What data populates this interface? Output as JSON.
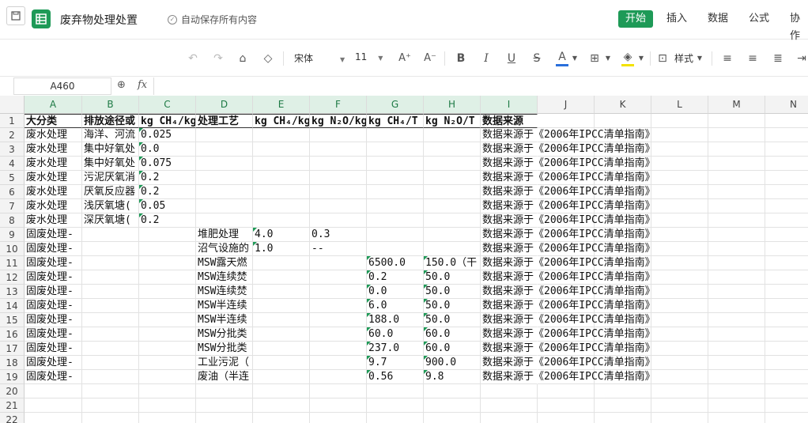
{
  "doc_title": "废弃物处理处置",
  "autosave_label": "自动保存所有内容",
  "menus": [
    "开始",
    "插入",
    "数据",
    "公式",
    "协作"
  ],
  "toolbar": {
    "font_name": "宋体",
    "font_size": "11",
    "style_label": "样式"
  },
  "name_box": "A460",
  "fx_label": "fx",
  "columns": [
    "A",
    "B",
    "C",
    "D",
    "E",
    "F",
    "G",
    "H",
    "I",
    "J",
    "K",
    "L",
    "M",
    "N"
  ],
  "rows": [
    [
      "大分类",
      "排放途径或",
      "kg CH₄/kg",
      "处理工艺",
      "kg CH₄/kg",
      "kg N₂O/kg",
      "kg CH₄/T",
      "kg N₂O/T",
      "数据来源"
    ],
    [
      "废水处理",
      "海洋、河流",
      "0.025",
      "",
      "",
      "",
      "",
      "",
      "数据来源于《2006年IPCC清单指南》"
    ],
    [
      "废水处理",
      "集中好氧处",
      "0.0",
      "",
      "",
      "",
      "",
      "",
      "数据来源于《2006年IPCC清单指南》"
    ],
    [
      "废水处理",
      "集中好氧处",
      "0.075",
      "",
      "",
      "",
      "",
      "",
      "数据来源于《2006年IPCC清单指南》"
    ],
    [
      "废水处理",
      "污泥厌氧消",
      "0.2",
      "",
      "",
      "",
      "",
      "",
      "数据来源于《2006年IPCC清单指南》"
    ],
    [
      "废水处理",
      "厌氧反应器",
      "0.2",
      "",
      "",
      "",
      "",
      "",
      "数据来源于《2006年IPCC清单指南》"
    ],
    [
      "废水处理",
      "浅厌氧塘(",
      "0.05",
      "",
      "",
      "",
      "",
      "",
      "数据来源于《2006年IPCC清单指南》"
    ],
    [
      "废水处理",
      "深厌氧塘(",
      "0.2",
      "",
      "",
      "",
      "",
      "",
      "数据来源于《2006年IPCC清单指南》"
    ],
    [
      "固废处理-",
      "",
      "",
      "堆肥处理",
      "4.0",
      "0.3",
      "",
      "",
      "数据来源于《2006年IPCC清单指南》"
    ],
    [
      "固废处理-",
      "",
      "",
      "沼气设施的",
      "1.0",
      "--",
      "",
      "",
      "数据来源于《2006年IPCC清单指南》"
    ],
    [
      "固废处理-",
      "",
      "",
      "MSW露天燃",
      "",
      "",
      "6500.0",
      "150.0（干",
      "数据来源于《2006年IPCC清单指南》"
    ],
    [
      "固废处理-",
      "",
      "",
      "MSW连续焚",
      "",
      "",
      "0.2",
      "50.0",
      "数据来源于《2006年IPCC清单指南》"
    ],
    [
      "固废处理-",
      "",
      "",
      "MSW连续焚",
      "",
      "",
      "0.0",
      "50.0",
      "数据来源于《2006年IPCC清单指南》"
    ],
    [
      "固废处理-",
      "",
      "",
      "MSW半连续",
      "",
      "",
      "6.0",
      "50.0",
      "数据来源于《2006年IPCC清单指南》"
    ],
    [
      "固废处理-",
      "",
      "",
      "MSW半连续",
      "",
      "",
      "188.0",
      "50.0",
      "数据来源于《2006年IPCC清单指南》"
    ],
    [
      "固废处理-",
      "",
      "",
      "MSW分批类",
      "",
      "",
      "60.0",
      "60.0",
      "数据来源于《2006年IPCC清单指南》"
    ],
    [
      "固废处理-",
      "",
      "",
      "MSW分批类",
      "",
      "",
      "237.0",
      "60.0",
      "数据来源于《2006年IPCC清单指南》"
    ],
    [
      "固废处理-",
      "",
      "",
      "工业污泥（",
      "",
      "",
      "9.7",
      "900.0",
      "数据来源于《2006年IPCC清单指南》"
    ],
    [
      "固废处理-",
      "",
      "",
      "废油（半连",
      "",
      "",
      "0.56",
      "9.8",
      "数据来源于《2006年IPCC清单指南》"
    ],
    [
      "",
      "",
      "",
      "",
      "",
      "",
      "",
      "",
      ""
    ],
    [
      "",
      "",
      "",
      "",
      "",
      "",
      "",
      "",
      ""
    ],
    [
      "",
      "",
      "",
      "",
      "",
      "",
      "",
      "",
      ""
    ]
  ],
  "row_numbers": [
    "1",
    "2",
    "3",
    "4",
    "5",
    "6",
    "7",
    "8",
    "9",
    "10",
    "11",
    "12",
    "13",
    "14",
    "15",
    "16",
    "17",
    "18",
    "19",
    "20",
    "21",
    "22"
  ]
}
